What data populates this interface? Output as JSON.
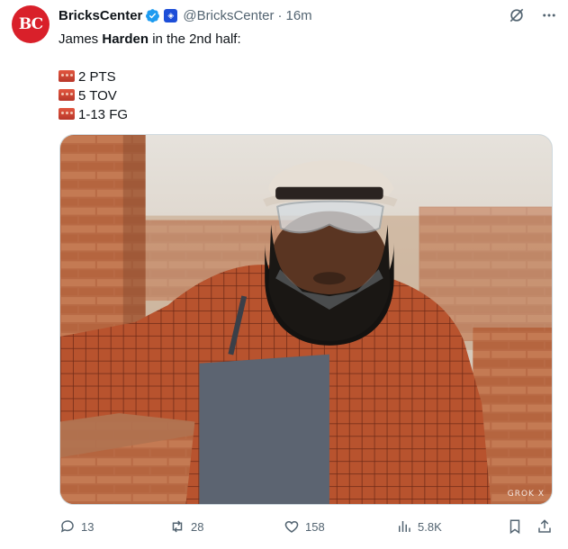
{
  "author": {
    "name": "BricksCenter",
    "handle": "@BricksCenter",
    "time": "16m",
    "separator": "·",
    "avatar_text": "BC",
    "avatar_color": "#d9202a",
    "verified_color": "#1d9bf0"
  },
  "tweet": {
    "intro_pre": "James ",
    "intro_bold": "Harden",
    "intro_post": " in the 2nd half:",
    "lines": [
      {
        "icon": "brick-emoji",
        "text": "2 PTS"
      },
      {
        "icon": "brick-emoji",
        "text": "5 TOV"
      },
      {
        "icon": "brick-emoji",
        "text": "1-13 FG"
      }
    ]
  },
  "media": {
    "watermark": "GROK X"
  },
  "actions": {
    "replies": "13",
    "retweets": "28",
    "likes": "158",
    "views": "5.8K"
  },
  "colors": {
    "muted": "#536471",
    "text": "#0f1419",
    "border": "#cfd9de"
  }
}
